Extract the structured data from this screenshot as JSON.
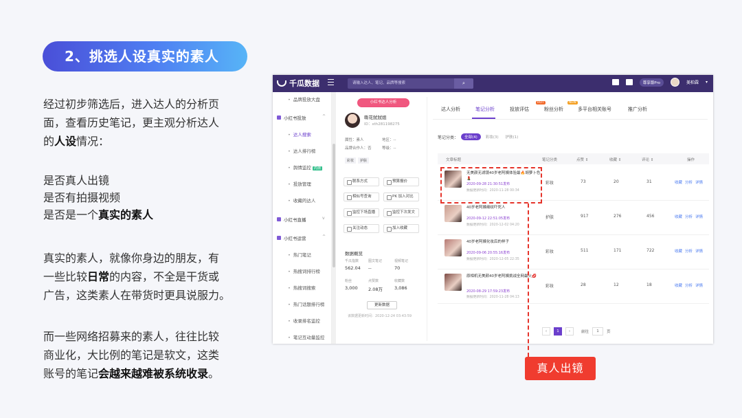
{
  "slide": {
    "title": "2、挑选人设真实的素人",
    "para1": {
      "l1": "经过初步筛选后，进入达人的分析页",
      "l2": "面，查看历史笔记，更主观分析达人",
      "l3a": "的",
      "l3b": "人设",
      "l3c": "情况："
    },
    "para2": {
      "l1": "是否真人出镜",
      "l2": "是否有拍摄视频",
      "l3a": "是否是一个",
      "l3b": "真实的素人"
    },
    "para3": {
      "l1": "真实的素人，就像你身边的朋友，有",
      "l2a": "一些比较",
      "l2b": "日常",
      "l2c": "的内容，不全是干货或",
      "l3": "广告，这类素人在带货时更具说服力。"
    },
    "para4": {
      "l1": "而一些网络招募来的素人，往往比较",
      "l2": "商业化，大比例的笔记是软文，这类",
      "l3a": "账号的笔记",
      "l3b": "会越来越难被系统收录",
      "l3c": "。"
    },
    "callout": "真人出镜"
  },
  "app": {
    "brand": "千瓜数据",
    "search_placeholder": "请输入达人、笔记、品牌等搜索",
    "plan": "尊享版Pro",
    "username": "美柏霖",
    "sidebar": {
      "top_item": "品牌投放大盘",
      "group1": "小红书投放",
      "g1_items": [
        "达人搜索",
        "达人排行榜",
        "舆情监控",
        "投放管理",
        "收藏的达人"
      ],
      "new_tag": "内测",
      "group2": "小红书直播",
      "group3": "小红书运营",
      "g3_items": [
        "热门笔记",
        "热搜词排行榜",
        "热搜词搜索",
        "热门话题排行榜",
        "收录排名监控",
        "笔记互动量监控"
      ]
    },
    "profile": {
      "tag": "小红书达人分析",
      "name": "嘶花鉽鉽姐",
      "id": "ID：xth281198275",
      "attr_label": "属性：素人",
      "region_label": "地区：--",
      "brand_label": "品牌合作人：否",
      "level_label": "等级：--",
      "tags": [
        "彩妆",
        "护肤"
      ],
      "buttons": [
        "联系方式",
        "预算报价",
        "相似号查询",
        "PK 加入对比",
        "监控下场直播",
        "监控下次发文",
        "关注动态",
        "加入收藏"
      ],
      "data_title": "数据概览",
      "stats": [
        {
          "label": "千瓜指数",
          "value": "562.04"
        },
        {
          "label": "图文笔记",
          "value": "--"
        },
        {
          "label": "视频笔记",
          "value": "70"
        },
        {
          "label": "粉丝",
          "value": "3,000"
        },
        {
          "label": "点赞数",
          "value": "2.08万"
        },
        {
          "label": "收藏数",
          "value": "3,086"
        }
      ],
      "update_btn": "更新数据",
      "update_time": "该数据更新时间：2020-12-24 03:43:59"
    },
    "tabs": [
      "达人分析",
      "笔记分析",
      "投放评估",
      "粉丝分析",
      "多平台相关账号",
      "推广分析"
    ],
    "badge_hot": "HOT",
    "badge_new": "NEW",
    "filter": {
      "label": "笔记分类：",
      "chips": [
        "全部(4)",
        "彩妆(3)",
        "护肤(1)"
      ]
    },
    "table": {
      "headers": [
        "文章标题",
        "笔记分类",
        "点赞 ⇕",
        "收藏 ⇕",
        "评论 ⇕",
        "操作"
      ],
      "rows": [
        {
          "title": "无美颜无滤镜40岁老阿姨体验最🔥胡萝卜色💄",
          "pub": "2020-09-28 21:30:51发布",
          "upd": "数据更新时间：2020-11-28 00:34",
          "cat": "彩妆",
          "likes": "73",
          "fav": "20",
          "cmt": "31",
          "color": "#5b3a35"
        },
        {
          "title": "40岁老阿姨细纹吓死人",
          "pub": "2020-09-12 22:51:05发布",
          "upd": "数据更新时间：2020-12-02 04:20",
          "cat": "护肤",
          "likes": "917",
          "fav": "276",
          "cmt": "456",
          "color": "#c99b8d"
        },
        {
          "title": "40岁老阿姨化妆后的样子",
          "pub": "2020-09-06 20:55:16发布",
          "upd": "数据更新时间：2020-12-05 22:35",
          "cat": "彩妆",
          "likes": "511",
          "fav": "171",
          "cmt": "722",
          "color": "#b77a74"
        },
        {
          "title": "原相机无美颜40岁老阿姨挑战全网最火💋",
          "pub": "2020-08-29 17:59:23发布",
          "upd": "数据更新时间：2020-11-28 04:13",
          "cat": "彩妆",
          "likes": "28",
          "fav": "12",
          "cmt": "18",
          "color": "#7d4a43"
        }
      ],
      "actions": [
        "收藏",
        "分析",
        "详情"
      ]
    },
    "pager": {
      "prev": "‹",
      "page": "1",
      "next": "›",
      "goto": "前往",
      "input": "1",
      "unit": "页"
    }
  }
}
